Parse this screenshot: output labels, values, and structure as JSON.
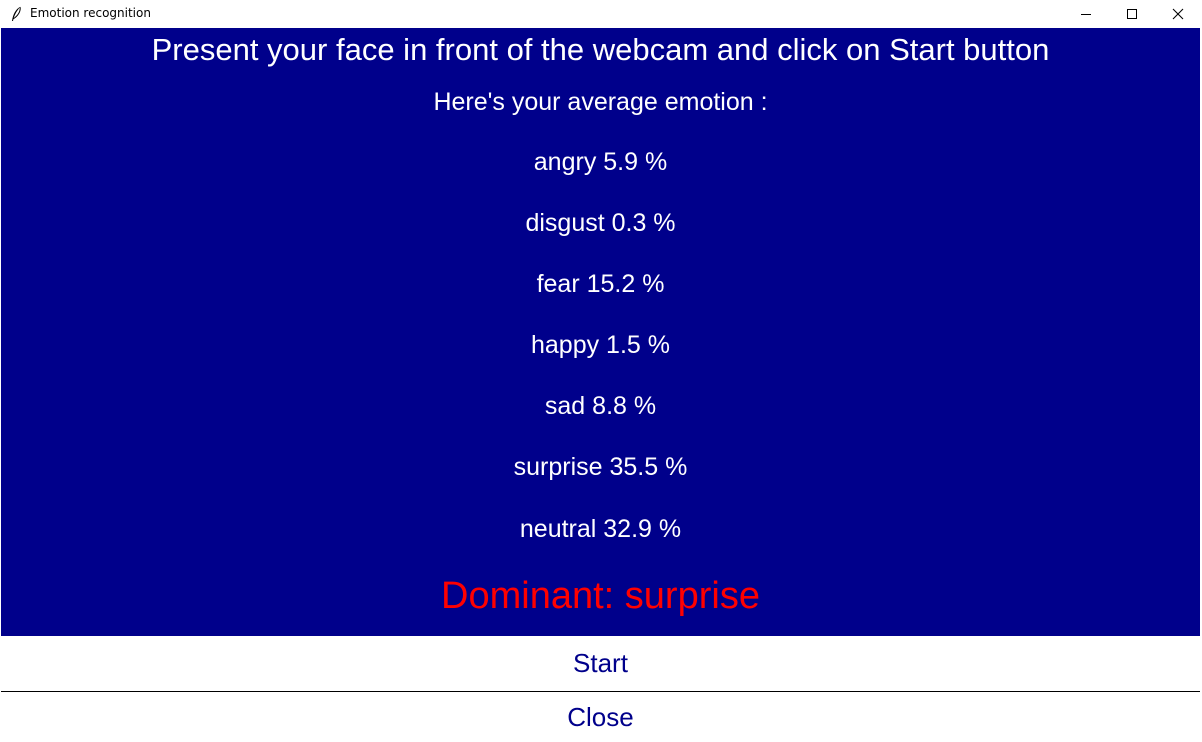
{
  "window": {
    "title": "Emotion recognition",
    "controls": [
      "minimize-icon",
      "maximize-icon",
      "close-icon"
    ]
  },
  "main": {
    "instruction": "Present your face in front of the webcam and click on Start button",
    "subtitle": "Here's your average emotion :",
    "emotions": [
      {
        "label": "angry 5.9 %"
      },
      {
        "label": "disgust 0.3 %"
      },
      {
        "label": "fear 15.2 %"
      },
      {
        "label": "happy 1.5 %"
      },
      {
        "label": "sad 8.8 %"
      },
      {
        "label": "surprise 35.5 %"
      },
      {
        "label": "neutral 32.9 %"
      }
    ],
    "dominant": "Dominant: surprise"
  },
  "buttons": {
    "start": "Start",
    "close": "Close"
  },
  "colors": {
    "panel_background": "#00008b",
    "text": "#ffffff",
    "dominant": "#ff0000",
    "button_text": "#00008b"
  }
}
